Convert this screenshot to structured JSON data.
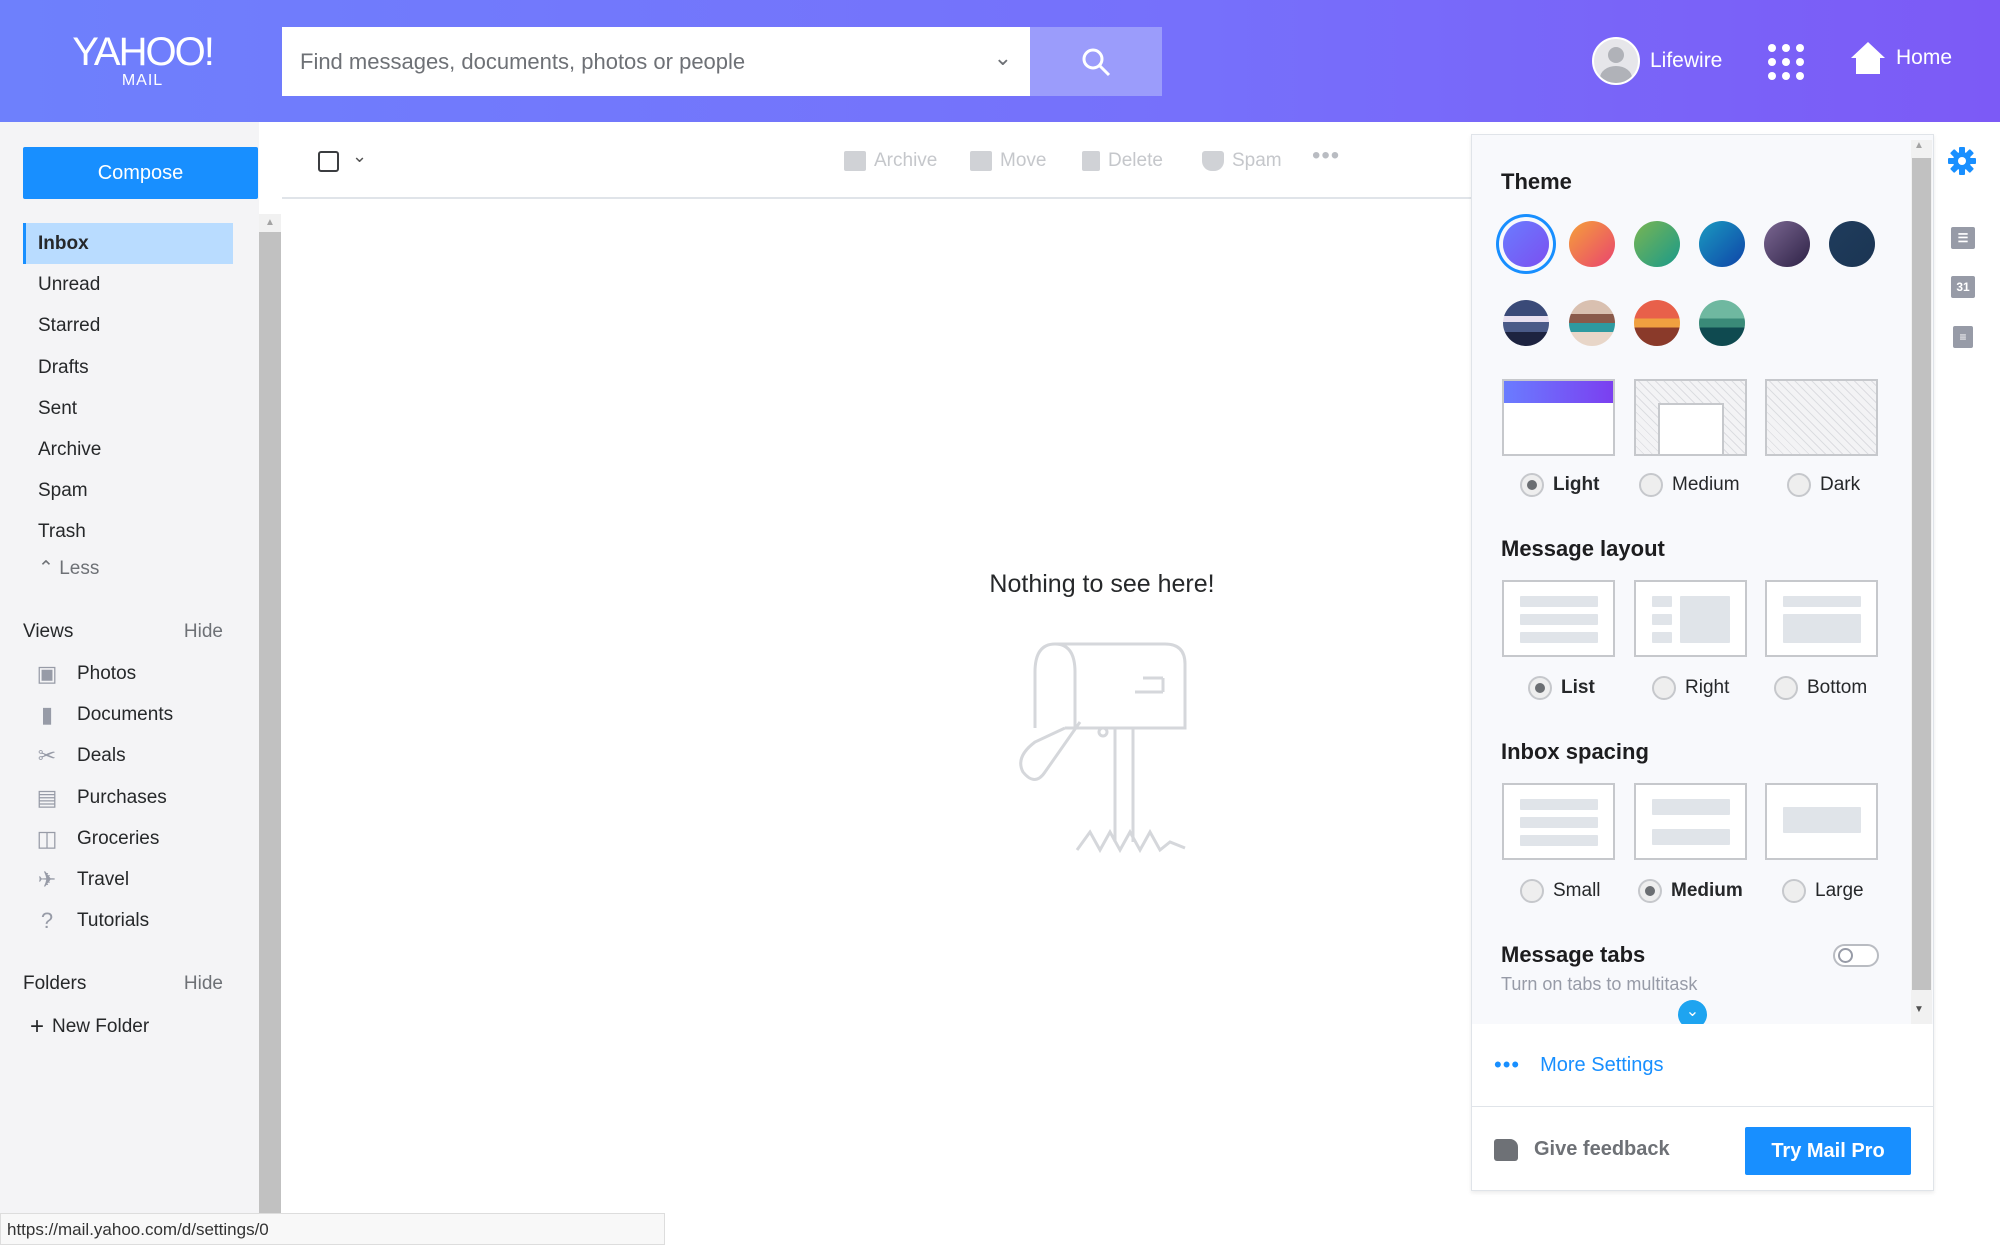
{
  "header": {
    "logo": "YAHOO!",
    "logo_sub": "MAIL",
    "search_placeholder": "Find messages, documents, photos or people",
    "user": "Lifewire",
    "home": "Home"
  },
  "sidebar": {
    "compose": "Compose",
    "folders": [
      "Inbox",
      "Unread",
      "Starred",
      "Drafts",
      "Sent",
      "Archive",
      "Spam",
      "Trash"
    ],
    "less": "Less",
    "views_title": "Views",
    "views_hide": "Hide",
    "views": [
      {
        "label": "Photos",
        "icon": "photo-icon"
      },
      {
        "label": "Documents",
        "icon": "document-icon"
      },
      {
        "label": "Deals",
        "icon": "scissors-icon"
      },
      {
        "label": "Purchases",
        "icon": "receipt-icon"
      },
      {
        "label": "Groceries",
        "icon": "basket-icon"
      },
      {
        "label": "Travel",
        "icon": "plane-icon"
      },
      {
        "label": "Tutorials",
        "icon": "help-icon"
      }
    ],
    "folders_title": "Folders",
    "folders_hide": "Hide",
    "new_folder": "New Folder"
  },
  "toolbar": {
    "archive": "Archive",
    "move": "Move",
    "delete": "Delete",
    "spam": "Spam"
  },
  "main": {
    "empty": "Nothing to see here!"
  },
  "settings": {
    "theme_title": "Theme",
    "theme_colors": [
      [
        "#6a7cff",
        "#7b4ff0"
      ],
      [
        "#f5a03a",
        "#e9446f"
      ],
      [
        "#7ab552",
        "#1a9a8a"
      ],
      [
        "#1a9ac0",
        "#0f44a8"
      ],
      [
        "#7b6792",
        "#2e2246"
      ],
      [
        "#1f3c5c",
        "#1b3553"
      ]
    ],
    "theme_images": [
      "mountains",
      "camper",
      "sunset",
      "lake"
    ],
    "selected_theme": 0,
    "modes": [
      "Light",
      "Medium",
      "Dark"
    ],
    "selected_mode": 0,
    "layout_title": "Message layout",
    "layouts": [
      "List",
      "Right",
      "Bottom"
    ],
    "selected_layout": 0,
    "spacing_title": "Inbox spacing",
    "spacings": [
      "Small",
      "Medium",
      "Large"
    ],
    "selected_spacing": 1,
    "tabs_title": "Message tabs",
    "tabs_sub": "Turn on tabs to multitask",
    "tabs_enabled": false,
    "more": "More Settings",
    "feedback": "Give feedback",
    "pro": "Try Mail Pro"
  },
  "status_url": "https://mail.yahoo.com/d/settings/0",
  "colors": {
    "accent": "#188fff",
    "header_start": "#6e80fc",
    "header_end": "#7c5af6"
  }
}
